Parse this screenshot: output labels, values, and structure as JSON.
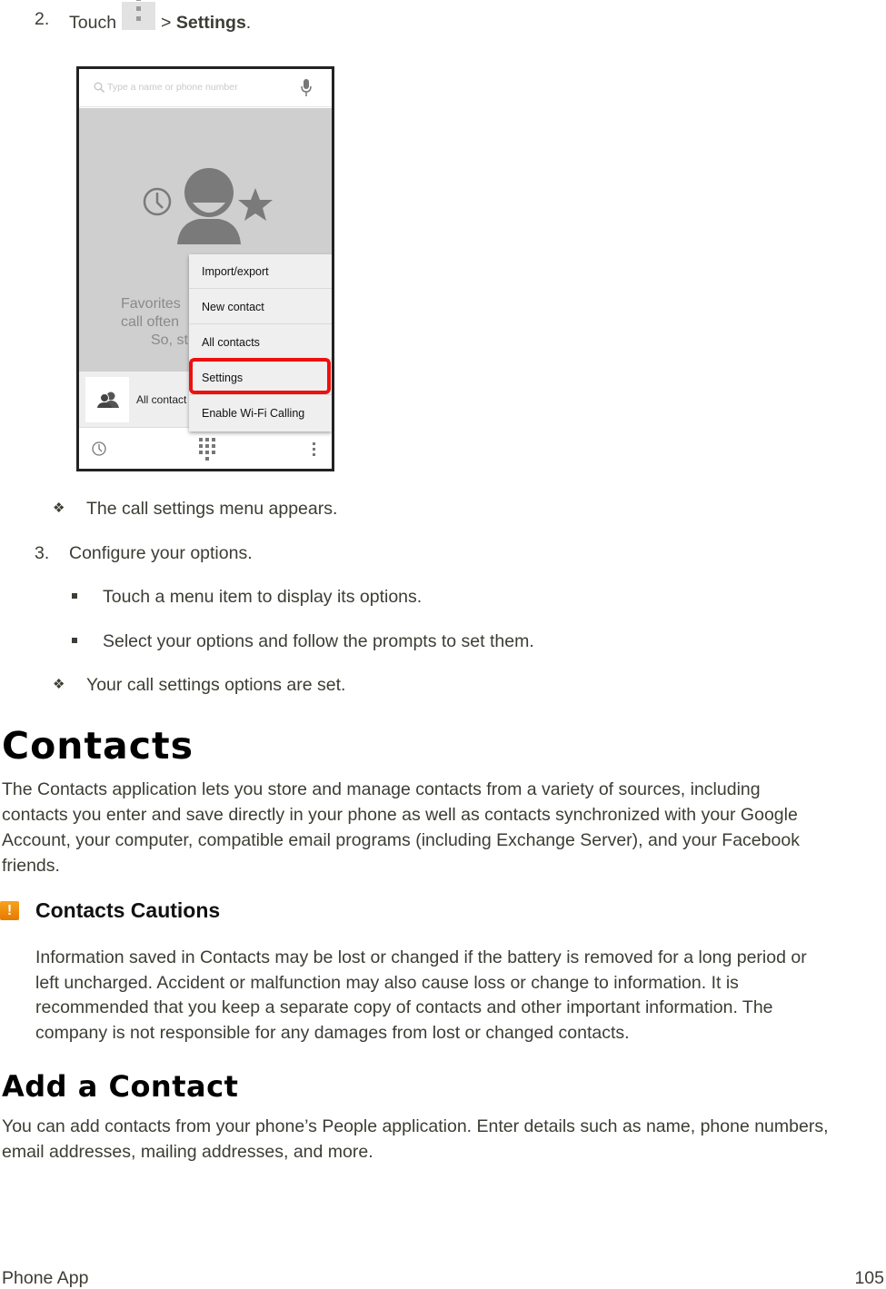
{
  "step2": {
    "number": "2.",
    "prefix": "Touch",
    "icon": "overflow-menu-icon",
    "separator": ">",
    "target": "Settings",
    "suffix": "."
  },
  "phone_screenshot": {
    "search_placeholder": "Type a name or phone number",
    "favorites_text": [
      "Favorites",
      "call often",
      "So, st"
    ],
    "all_contacts_label": "All contact",
    "menu_items": [
      {
        "label": "Import/export"
      },
      {
        "label": "New contact"
      },
      {
        "label": "All contacts"
      },
      {
        "label": "Settings",
        "highlighted": true
      },
      {
        "label": "Enable Wi-Fi Calling"
      }
    ],
    "highlight_color": "#ee1010"
  },
  "result1": "The call settings menu appears.",
  "step3": {
    "number": "3.",
    "text": "Configure your options.",
    "sub_bullets": [
      "Touch a menu item to display its options.",
      "Select your options and follow the prompts to set them."
    ]
  },
  "result2": "Your call settings options are set.",
  "contacts": {
    "heading": "Contacts",
    "intro_lines": [
      "The Contacts application lets you store and manage contacts from a variety of sources, including",
      "contacts you enter and save directly in your phone as well as contacts synchronized with your Google",
      "Account, your computer, compatible email programs (including Exchange Server), and your Facebook",
      "friends."
    ]
  },
  "caution": {
    "icon": "warning-icon",
    "icon_color": "#f08c0c",
    "title": "Contacts Cautions",
    "lines": [
      "Information saved in Contacts may be lost or changed if the battery is removed for a long period or",
      "left uncharged. Accident or malfunction may also cause loss or change to information. It is",
      "recommended that you keep a separate copy of contacts and other important information. The",
      "company is not responsible for any damages from lost or changed contacts."
    ]
  },
  "add_contact": {
    "heading": "Add a Contact",
    "lines": [
      "You can add contacts from your phone’s People application. Enter details such as name, phone numbers,",
      "email addresses, mailing addresses, and more."
    ]
  },
  "footer": {
    "section": "Phone App",
    "page_number": "105"
  }
}
